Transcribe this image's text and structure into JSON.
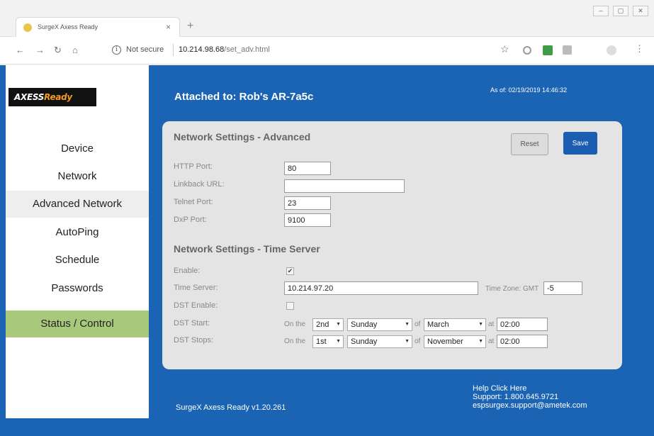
{
  "browser": {
    "tab_title": "SurgeX Axess Ready",
    "tab_close": "×",
    "new_tab": "+",
    "not_secure": "Not secure",
    "url_host": "10.214.98.68",
    "url_path": "/set_adv.html"
  },
  "sidebar": {
    "logo_main": "AXESS",
    "logo_accent": "Ready",
    "items": [
      {
        "label": "Device",
        "active": false
      },
      {
        "label": "Network",
        "active": false
      },
      {
        "label": "Advanced Network",
        "active": true
      },
      {
        "label": "AutoPing",
        "active": false
      },
      {
        "label": "Schedule",
        "active": false
      },
      {
        "label": "Passwords",
        "active": false
      }
    ],
    "status_control": "Status / Control"
  },
  "header": {
    "attached": "Attached to: Rob's AR-7a5c",
    "as_of": "As of: 02/19/2019 14:46:32"
  },
  "advanced": {
    "title": "Network Settings - Advanced",
    "reset_label": "Reset",
    "save_label": "Save",
    "http_port_label": "HTTP Port:",
    "http_port": "80",
    "linkback_label": "Linkback URL:",
    "linkback_url": "",
    "telnet_label": "Telnet Port:",
    "telnet_port": "23",
    "dxp_label": "DxP Port:",
    "dxp_port": "9100"
  },
  "time_server": {
    "title": "Network Settings - Time Server",
    "enable_label": "Enable:",
    "enable_checked": true,
    "server_label": "Time Server:",
    "server": "10.214.97.20",
    "tz_label": "Time Zone: GMT",
    "tz": "-5",
    "dst_enable_label": "DST Enable:",
    "dst_enable_checked": false,
    "dst_start_label": "DST Start:",
    "dst_stops_label": "DST Stops:",
    "on_the": "On the",
    "of": "of",
    "at": "at",
    "dst_start": {
      "week": "2nd",
      "day": "Sunday",
      "month": "March",
      "time": "02:00"
    },
    "dst_stop": {
      "week": "1st",
      "day": "Sunday",
      "month": "November",
      "time": "02:00"
    }
  },
  "footer": {
    "version": "SurgeX Axess Ready v1.20.261",
    "help": "Help Click Here",
    "support": "Support: 1.800.645.9721",
    "email": "espsurgex.support@ametek.com"
  }
}
